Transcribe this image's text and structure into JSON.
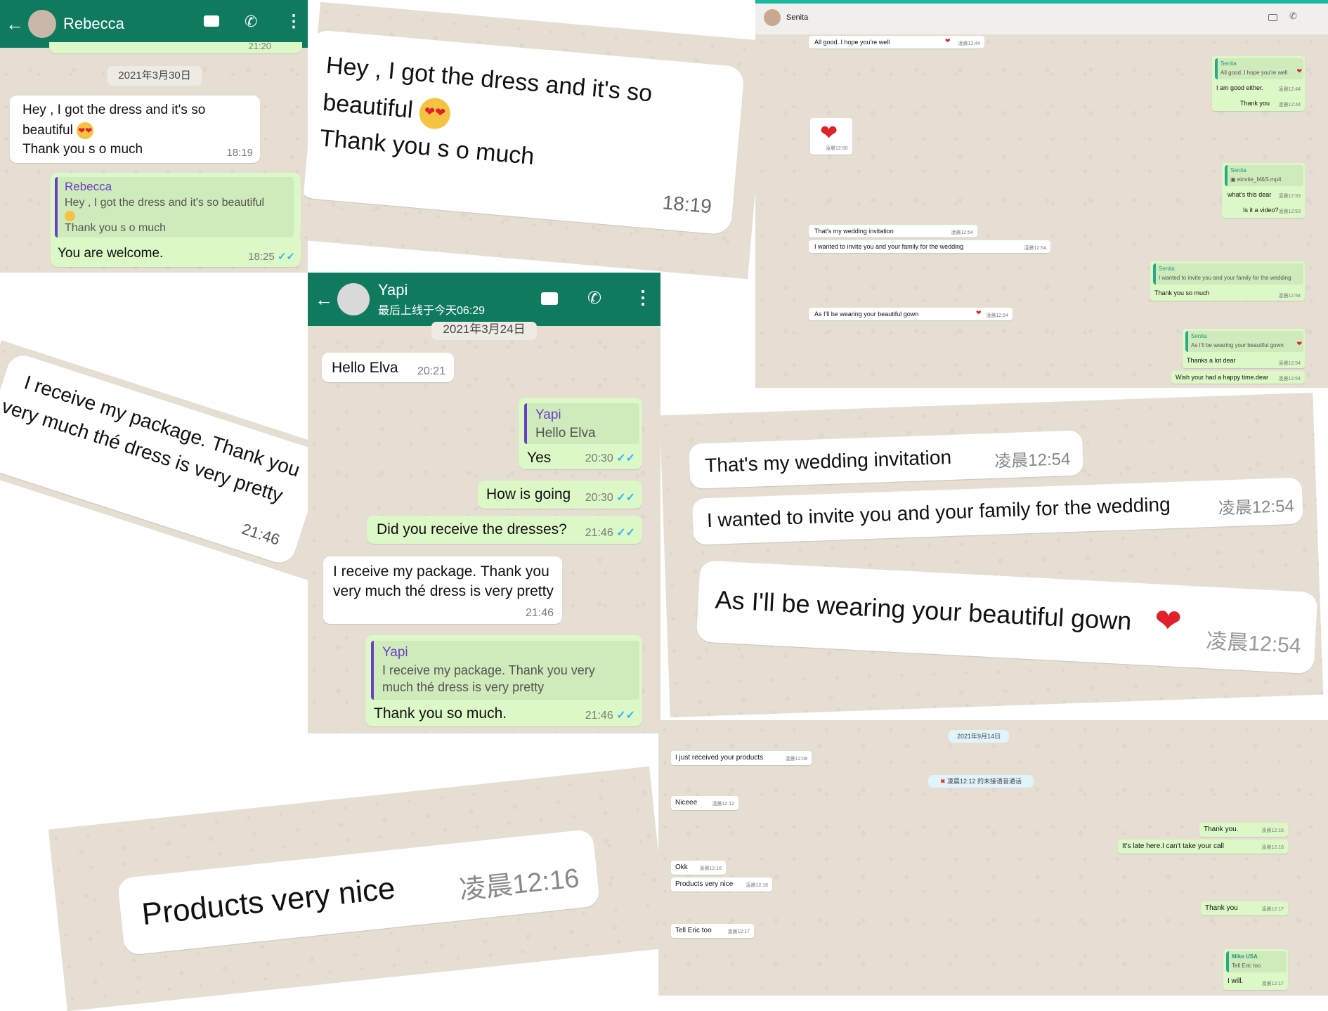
{
  "panel_rebecca": {
    "contact": "Rebecca",
    "header_cut_time": "21:20",
    "date": "2021年3月30日",
    "msg_in": [
      "Hey , I got the dress and it's so",
      "beautiful",
      "Thank you s o much"
    ],
    "msg_in_time": "18:19",
    "reply_quote_name": "Rebecca",
    "reply_quote_text": [
      "Hey , I got the dress and it's so beautiful",
      "Thank you s o much"
    ],
    "reply_text": "You are welcome.",
    "reply_time": "18:25"
  },
  "zoom_dress": {
    "lines": [
      "Hey , I got the dress and it's so",
      "beautiful",
      "Thank you s o much"
    ],
    "time": "18:19"
  },
  "zoom_package": {
    "lines": [
      "I receive my package. Thank you",
      "very much thé dress is very pretty"
    ],
    "time": "21:46"
  },
  "panel_yapi": {
    "contact": "Yapi",
    "status": "最后上线于今天06:29",
    "date": "2021年3月24日",
    "msg1": "Hello Elva",
    "msg1_time": "20:21",
    "q1_name": "Yapi",
    "q1_text": "Hello Elva",
    "msg2": "Yes",
    "msg2_time": "20:30",
    "msg3": "How is going",
    "msg3_time": "20:30",
    "msg4": "Did you receive the dresses?",
    "msg4_time": "21:46",
    "msg5": [
      "I receive my package. Thank you",
      "very much thé dress is very pretty"
    ],
    "msg5_time": "21:46",
    "q2_name": "Yapi",
    "q2_text": [
      "I receive my package. Thank you very",
      "much thé dress is very pretty"
    ],
    "msg6": "Thank you so much.",
    "msg6_time": "21:46"
  },
  "panel_senita": {
    "contact": "Senita",
    "m1": "All good..I hope you're well",
    "m1_t": "凌晨12:44",
    "q1_name": "Senita",
    "q1_text": "All good..I hope you're well",
    "m2": "I am good either.",
    "m2_t": "凌晨12:44",
    "m3": "Thank you",
    "m3_t": "凌晨12:44",
    "m4_t": "凌晨12:50",
    "q2_name": "Senita",
    "q2_file": "einvite_M&S.mp4",
    "m5": "what's this dear",
    "m5_t": "凌晨12:53",
    "m6": "Is it a video?",
    "m6_t": "凌晨12:53",
    "m7": "That's my wedding invitation",
    "m7_t": "凌晨12:54",
    "m8": "I wanted to invite you and your family for the wedding",
    "m8_t": "凌晨12:54",
    "q3_name": "Senita",
    "q3_text": "I wanted to invite you and your family for the wedding",
    "m9": "Thank you so much",
    "m9_t": "凌晨12:54",
    "m10": "As I'll be wearing your beautiful gown",
    "m10_t": "凌晨12:54",
    "q4_name": "Senita",
    "q4_text": "As I'll be wearing your beautiful gown",
    "m11": "Thanks a lot dear",
    "m11_t": "凌晨12:54",
    "m12": "Wish your had a happy time.dear",
    "m12_t": "凌晨12:54"
  },
  "zoom_wedding": {
    "m1": "That's my wedding invitation",
    "m1_t": "凌晨12:54",
    "m2": "I wanted to invite you and your family for the wedding",
    "m2_t": "凌晨12:54",
    "m3": "As I'll be wearing your beautiful gown",
    "m3_t": "凌晨12:54"
  },
  "zoom_products": {
    "text": "Products very nice",
    "time": "凌晨12:16"
  },
  "panel_mike": {
    "date": "2021年9月14日",
    "m1": "I just received your products",
    "m1_t": "凌晨12:08",
    "missed_call": "凌晨12:12 的未接语音通话",
    "m2": "Niceee",
    "m2_t": "凌晨12:12",
    "m3": "Thank you.",
    "m3_t": "凌晨12:16",
    "m4": "It's late here.I can't take your call",
    "m4_t": "凌晨12:16",
    "m5": "Okk",
    "m5_t": "凌晨12:16",
    "m6": "Products very nice",
    "m6_t": "凌晨12:16",
    "m7": "Thank you",
    "m7_t": "凌晨12:17",
    "m8": "Tell Eric too",
    "m8_t": "凌晨12:17",
    "q_name": "Mike USA",
    "q_text": "Tell Eric too",
    "m9": "I will.",
    "m9_t": "凌晨12:17"
  },
  "icons": [
    "back-arrow-icon",
    "video-call-icon",
    "phone-icon",
    "more-options-icon",
    "double-tick-icon",
    "heart-icon",
    "heart-eyes-emoji-icon",
    "missed-call-icon",
    "video-file-icon"
  ],
  "colors": {
    "header": "#0f7a5e",
    "outgoing": "#dcf8c6",
    "incoming": "#ffffff",
    "tick": "#34b7f1",
    "quote_bar": "#6a3fc8"
  }
}
